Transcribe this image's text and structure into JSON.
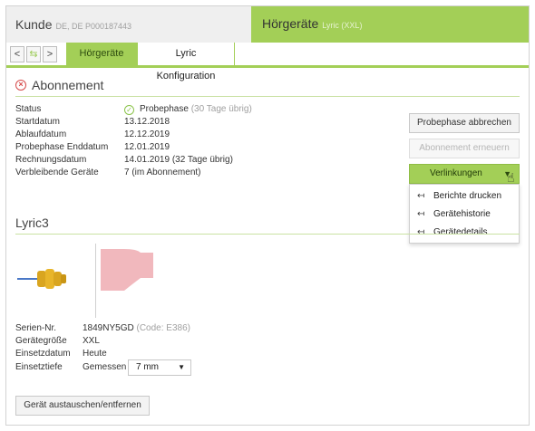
{
  "header": {
    "kunde_title": "Kunde",
    "kunde_sub": "DE, DE P000187443",
    "geraete_title": "Hörgeräte",
    "geraete_sub": "Lyric (XXL)"
  },
  "nav": {
    "back": "<",
    "swap": "⇆",
    "forward": ">"
  },
  "tabs": [
    {
      "label": "Hörgeräte",
      "active": false
    },
    {
      "label": "Lyric Konfiguration",
      "active": true
    }
  ],
  "abonnement": {
    "title": "Abonnement",
    "rows": [
      {
        "label": "Status",
        "value": "Probephase",
        "note": "(30 Tage übrig)"
      },
      {
        "label": "Startdatum",
        "value": "13.12.2018"
      },
      {
        "label": "Ablaufdatum",
        "value": "12.12.2019"
      },
      {
        "label": "Probephase Enddatum",
        "value": "12.01.2019"
      },
      {
        "label": "Rechnungsdatum",
        "value": "14.01.2019 (32 Tage übrig)"
      },
      {
        "label": "Verbleibende Geräte",
        "value": "7 (im Abonnement)"
      }
    ]
  },
  "actions": {
    "abbrechen": "Probephase abbrechen",
    "erneuern": "Abonnement erneuern",
    "verlinkungen": "Verlinkungen",
    "menu": [
      "Berichte drucken",
      "Gerätehistorie",
      "Gerätedetails"
    ]
  },
  "lyric": {
    "title": "Lyric3",
    "serial_label": "Serien-Nr.",
    "serial_value": "1849NY5GD",
    "serial_code": "(Code: E386)",
    "size_label": "Gerätegröße",
    "size_value": "XXL",
    "date_label": "Einsetzdatum",
    "date_value": "Heute",
    "depth_label": "Einsetztiefe",
    "depth_mode": "Gemessen",
    "depth_value": "7 mm",
    "replace_button": "Gerät austauschen/entfernen"
  },
  "colors": {
    "accent": "#a3cf57",
    "error": "#d64a4a",
    "success": "#8bc34a"
  }
}
